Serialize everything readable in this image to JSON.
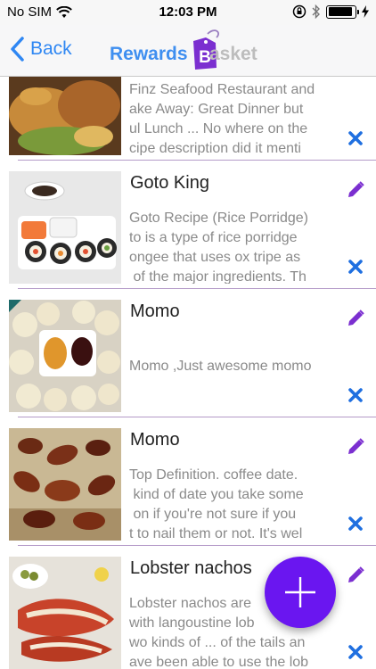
{
  "status_bar": {
    "carrier": "No SIM",
    "time": "12:03 PM",
    "battery_level": 0.9
  },
  "nav": {
    "back_label": "Back",
    "logo_left": "Rewards",
    "logo_badge": "B",
    "logo_right": "asket"
  },
  "colors": {
    "accent": "#6a16f0",
    "link": "#2f87f3",
    "edit": "#7b2fd0",
    "delete": "#1f6fe0"
  },
  "items": [
    {
      "title": "",
      "description": "Finz Seafood Restaurant and\nake Away: Great Dinner but\nul Lunch ... No where on the\ncipe description did it menti",
      "thumbnail": "seafood-dish"
    },
    {
      "title": "Goto King",
      "description": "Goto Recipe (Rice Porridge)\nto is a type of rice porridge\nongee that uses ox tripe as\n of the major ingredients. Th",
      "thumbnail": "sushi-plate"
    },
    {
      "title": "Momo",
      "description": "\nMomo ,Just awesome momo",
      "thumbnail": "momo-dumplings"
    },
    {
      "title": "Momo",
      "description": "Top Definition. coffee date.\n kind of date you take some\n on if you're not sure if you\nt to nail them or not. It's wel",
      "thumbnail": "dates-fruit"
    },
    {
      "title": "Lobster nachos",
      "description": "Lobster nachos are\nwith langoustine lob\nwo kinds of ... of the tails an\nave been able to use the lob",
      "thumbnail": "lobster-platter"
    }
  ],
  "icons": {
    "edit": "pencil-icon",
    "delete": "close-icon",
    "add": "plus-icon",
    "back": "chevron-left-icon"
  }
}
